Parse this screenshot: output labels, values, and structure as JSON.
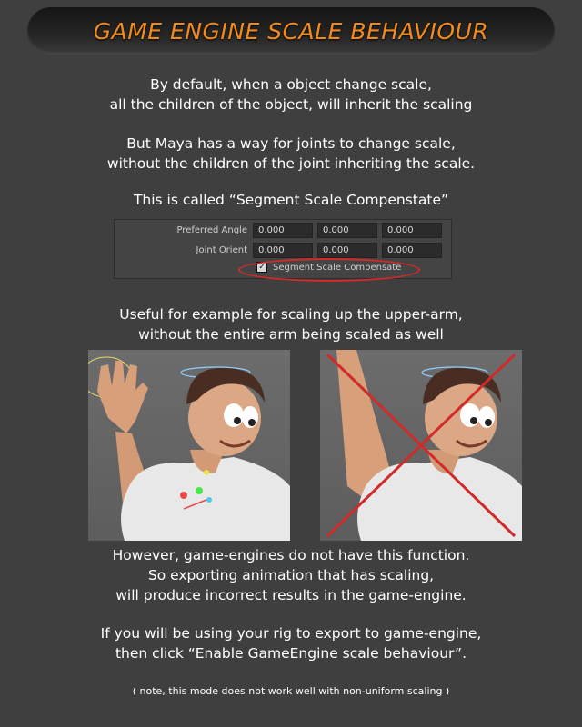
{
  "title": "GAME ENGINE SCALE BEHAVIOUR",
  "intro": [
    "By default, when a object change scale,",
    "all the children of the object, will inherit the scaling"
  ],
  "maya_note": [
    "But Maya has a way for joints to change scale,",
    "without the children of the joint inheriting the scale."
  ],
  "called": "This is called “Segment Scale Compenstate”",
  "panel": {
    "rows": [
      {
        "label": "Preferred Angle",
        "values": [
          "0.000",
          "0.000",
          "0.000"
        ]
      },
      {
        "label": "Joint Orient",
        "values": [
          "0.000",
          "0.000",
          "0.000"
        ]
      }
    ],
    "checkbox_label": "Segment Scale Compensate",
    "checkbox_checked": true
  },
  "useful": [
    "Useful for example for scaling up the upper-arm,",
    "without the entire arm being scaled as well"
  ],
  "however": [
    "However, game-engines do not have this function.",
    "So exporting animation that has scaling,",
    "will produce incorrect results in the game-engine."
  ],
  "export_note": [
    "If you will be using your rig to export to game-engine,",
    "then click “Enable GameEngine scale behaviour”."
  ],
  "footnote": "( note, this mode does not work well with non-uniform scaling )",
  "colors": {
    "accent": "#f18a1c",
    "highlight": "#d12a2a"
  }
}
